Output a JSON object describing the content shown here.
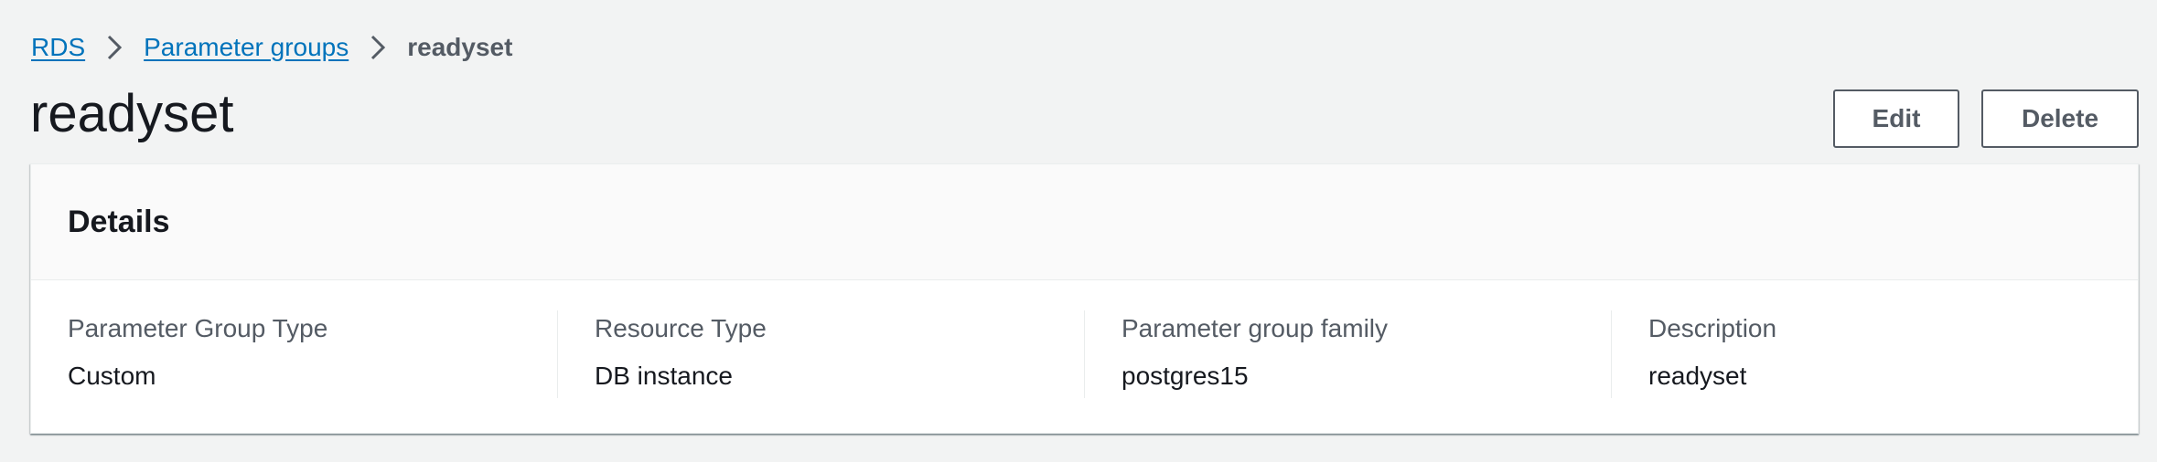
{
  "breadcrumb": {
    "items": [
      {
        "label": "RDS"
      },
      {
        "label": "Parameter groups"
      },
      {
        "label": "readyset"
      }
    ]
  },
  "header": {
    "title": "readyset",
    "edit_label": "Edit",
    "delete_label": "Delete"
  },
  "details": {
    "title": "Details",
    "fields": [
      {
        "label": "Parameter Group Type",
        "value": "Custom"
      },
      {
        "label": "Resource Type",
        "value": "DB instance"
      },
      {
        "label": "Parameter group family",
        "value": "postgres15"
      },
      {
        "label": "Description",
        "value": "readyset"
      }
    ]
  },
  "colors": {
    "link": "#0073bb",
    "background": "#f2f3f3",
    "button_border": "#545b64"
  },
  "icons": {
    "separator": "chevron-right-icon"
  }
}
